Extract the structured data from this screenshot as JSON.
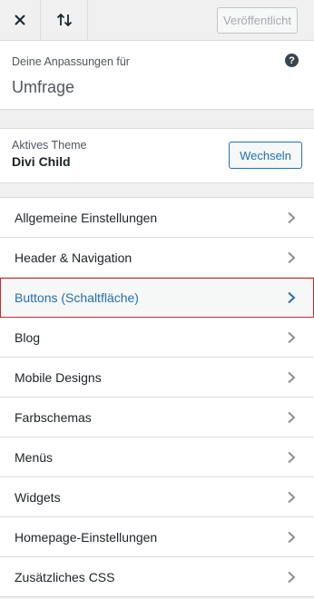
{
  "topbar": {
    "close_icon": "close-icon",
    "sort_icon": "sort-arrows-icon",
    "publish_label": "Veröffentlicht"
  },
  "info": {
    "label": "Deine Anpassungen für",
    "title": "Umfrage",
    "help_icon": "help-icon",
    "help_glyph": "?"
  },
  "theme": {
    "label": "Aktives Theme",
    "name": "Divi Child",
    "change_label": "Wechseln"
  },
  "menu": {
    "items": [
      {
        "label": "Allgemeine Einstellungen"
      },
      {
        "label": "Header & Navigation"
      },
      {
        "label": "Buttons (Schaltfläche)",
        "active": true
      },
      {
        "label": "Blog"
      },
      {
        "label": "Mobile Designs"
      },
      {
        "label": "Farbschemas"
      },
      {
        "label": "Menüs"
      },
      {
        "label": "Widgets"
      },
      {
        "label": "Homepage-Einstellungen"
      },
      {
        "label": "Zusätzliches CSS"
      }
    ]
  },
  "colors": {
    "accent": "#2271b1",
    "active_border": "#c92a2a"
  }
}
